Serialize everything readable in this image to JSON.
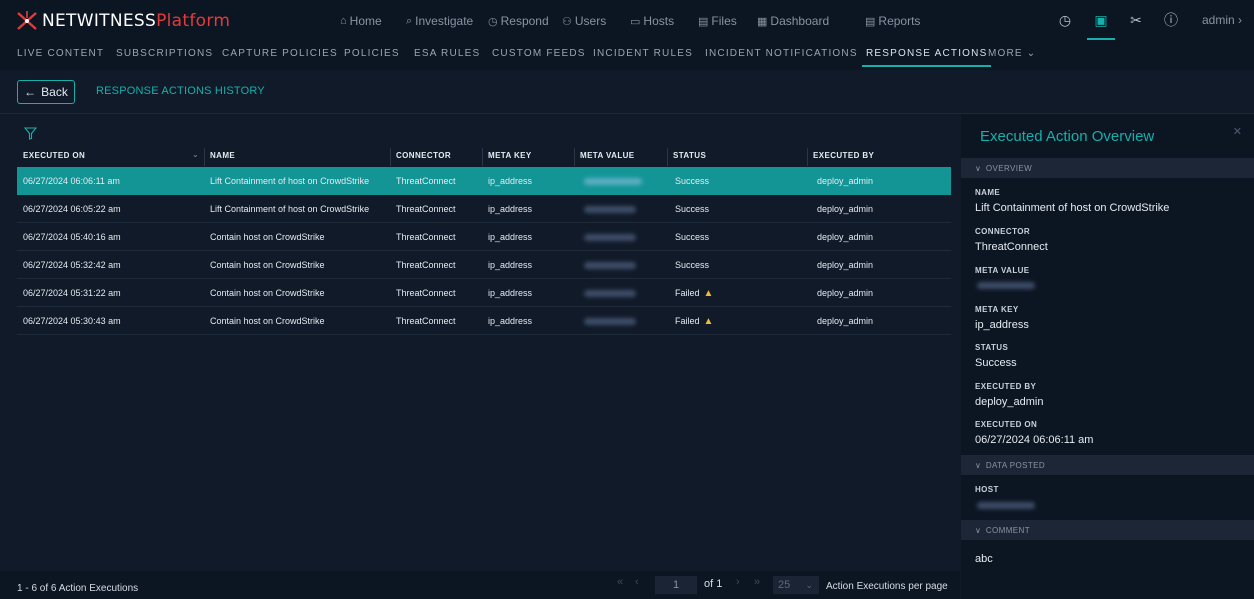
{
  "app": {
    "brand_main": "NETWITNESS",
    "brand_sub": "Platform"
  },
  "main_nav": [
    {
      "label": "Home",
      "icon": "home-icon"
    },
    {
      "label": "Investigate",
      "icon": "investigate-icon"
    },
    {
      "label": "Respond",
      "icon": "respond-icon"
    },
    {
      "label": "Users",
      "icon": "users-icon"
    },
    {
      "label": "Hosts",
      "icon": "hosts-icon"
    },
    {
      "label": "Files",
      "icon": "files-icon"
    },
    {
      "label": "Dashboard",
      "icon": "dashboard-icon"
    },
    {
      "label": "Reports",
      "icon": "reports-icon"
    }
  ],
  "top_icons": [
    "timer-icon",
    "admin-config-icon",
    "tools-icon",
    "help-icon"
  ],
  "user": {
    "label": "admin"
  },
  "sub_nav": [
    "LIVE CONTENT",
    "SUBSCRIPTIONS",
    "CAPTURE POLICIES",
    "POLICIES",
    "ESA RULES",
    "CUSTOM FEEDS",
    "INCIDENT RULES",
    "INCIDENT NOTIFICATIONS",
    "RESPONSE ACTIONS",
    "MORE"
  ],
  "sub_nav_active": "RESPONSE ACTIONS",
  "back_label": "Back",
  "history_label": "RESPONSE ACTIONS HISTORY",
  "table": {
    "columns": [
      "EXECUTED ON",
      "NAME",
      "CONNECTOR",
      "META KEY",
      "META VALUE",
      "STATUS",
      "EXECUTED BY"
    ],
    "rows": [
      {
        "executed_on": "06/27/2024 06:06:11 am",
        "name": "Lift Containment of host on CrowdStrike",
        "connector": "ThreatConnect",
        "meta_key": "ip_address",
        "status": "Success",
        "executed_by": "deploy_admin",
        "warning": false,
        "selected": true
      },
      {
        "executed_on": "06/27/2024 06:05:22 am",
        "name": "Lift Containment of host on CrowdStrike",
        "connector": "ThreatConnect",
        "meta_key": "ip_address",
        "status": "Success",
        "executed_by": "deploy_admin",
        "warning": false,
        "selected": false
      },
      {
        "executed_on": "06/27/2024 05:40:16 am",
        "name": "Contain host on CrowdStrike",
        "connector": "ThreatConnect",
        "meta_key": "ip_address",
        "status": "Success",
        "executed_by": "deploy_admin",
        "warning": false,
        "selected": false
      },
      {
        "executed_on": "06/27/2024 05:32:42 am",
        "name": "Contain host on CrowdStrike",
        "connector": "ThreatConnect",
        "meta_key": "ip_address",
        "status": "Success",
        "executed_by": "deploy_admin",
        "warning": false,
        "selected": false
      },
      {
        "executed_on": "06/27/2024 05:31:22 am",
        "name": "Contain host on CrowdStrike",
        "connector": "ThreatConnect",
        "meta_key": "ip_address",
        "status": "Failed",
        "executed_by": "deploy_admin",
        "warning": true,
        "selected": false
      },
      {
        "executed_on": "06/27/2024 05:30:43 am",
        "name": "Contain host on CrowdStrike",
        "connector": "ThreatConnect",
        "meta_key": "ip_address",
        "status": "Failed",
        "executed_by": "deploy_admin",
        "warning": true,
        "selected": false
      }
    ]
  },
  "footer": {
    "count_text": "1 - 6 of 6 Action Executions",
    "page_value": "1",
    "of_text": "of 1",
    "page_size": "25",
    "per_page_label": "Action Executions per page"
  },
  "panel": {
    "title": "Executed Action Overview",
    "sections": {
      "overview": "OVERVIEW",
      "data_posted": "DATA POSTED",
      "comment": "COMMENT"
    },
    "fields": {
      "name_label": "NAME",
      "name_value": "Lift Containment of host on CrowdStrike",
      "connector_label": "CONNECTOR",
      "connector_value": "ThreatConnect",
      "meta_value_label": "META VALUE",
      "meta_key_label": "META KEY",
      "meta_key_value": "ip_address",
      "status_label": "STATUS",
      "status_value": "Success",
      "executed_by_label": "EXECUTED BY",
      "executed_by_value": "deploy_admin",
      "executed_on_label": "EXECUTED ON",
      "executed_on_value": "06/27/2024 06:06:11 am",
      "host_label": "HOST",
      "comment_value": "abc"
    }
  },
  "colors": {
    "accent": "#16b0ab",
    "selected_row": "#139596",
    "brand_red": "#e23b3b",
    "warning": "#f0b93a"
  }
}
